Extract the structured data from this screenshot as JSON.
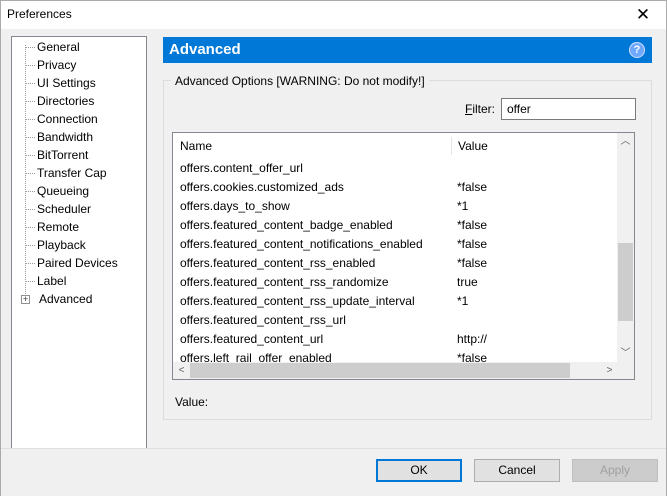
{
  "window": {
    "title": "Preferences",
    "close_glyph": "✕"
  },
  "sidebar": {
    "items": [
      {
        "label": "General"
      },
      {
        "label": "Privacy"
      },
      {
        "label": "UI Settings"
      },
      {
        "label": "Directories"
      },
      {
        "label": "Connection"
      },
      {
        "label": "Bandwidth"
      },
      {
        "label": "BitTorrent"
      },
      {
        "label": "Transfer Cap"
      },
      {
        "label": "Queueing"
      },
      {
        "label": "Scheduler"
      },
      {
        "label": "Remote"
      },
      {
        "label": "Playback"
      },
      {
        "label": "Paired Devices"
      },
      {
        "label": "Label"
      },
      {
        "label": "Advanced",
        "selected": true
      }
    ],
    "expander_glyph": "+"
  },
  "header": {
    "title": "Advanced",
    "help_glyph": "?"
  },
  "group": {
    "legend": "Advanced Options [WARNING: Do not modify!]",
    "filter_label_prefix": "F",
    "filter_label_rest": "ilter:",
    "filter_value": "offer"
  },
  "list": {
    "columns": [
      "Name",
      "Value"
    ],
    "rows": [
      {
        "name": "offers.content_offer_url",
        "value": ""
      },
      {
        "name": "offers.cookies.customized_ads",
        "value": "*false"
      },
      {
        "name": "offers.days_to_show",
        "value": "*1"
      },
      {
        "name": "offers.featured_content_badge_enabled",
        "value": "*false"
      },
      {
        "name": "offers.featured_content_notifications_enabled",
        "value": "*false"
      },
      {
        "name": "offers.featured_content_rss_enabled",
        "value": "*false"
      },
      {
        "name": "offers.featured_content_rss_randomize",
        "value": "true"
      },
      {
        "name": "offers.featured_content_rss_update_interval",
        "value": "*1"
      },
      {
        "name": "offers.featured_content_rss_url",
        "value": ""
      },
      {
        "name": "offers.featured_content_url",
        "value": "http://"
      },
      {
        "name": "offers.left_rail_offer_enabled",
        "value": "*false"
      }
    ],
    "scroll_up": "︿",
    "scroll_down": "﹀",
    "scroll_left": "<",
    "scroll_right": ">"
  },
  "value_label": "Value:",
  "buttons": {
    "ok": "OK",
    "cancel": "Cancel",
    "apply": "Apply"
  },
  "colors": {
    "accent": "#0078d7"
  }
}
